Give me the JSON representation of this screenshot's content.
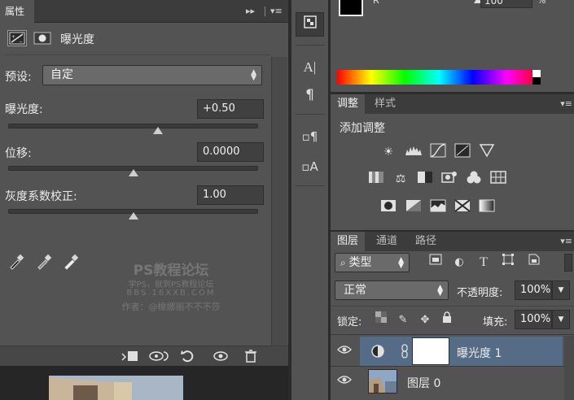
{
  "properties": {
    "tab_label": "属性",
    "title": "曝光度",
    "preset_label": "预设:",
    "preset_value": "自定",
    "exposure": {
      "label": "曝光度:",
      "value": "+0.50",
      "slider": 0.6
    },
    "offset": {
      "label": "位移:",
      "value": "0.0000",
      "slider": 0.5
    },
    "gamma": {
      "label": "灰度系数校正:",
      "value": "1.00",
      "slider": 0.5
    },
    "watermark": {
      "line1": "PS教程论坛",
      "line2": "学PS，就到PS教程论坛",
      "line3": "BBS.16XXB.COM",
      "line4": "作者：@椽娜丽不不不莎"
    }
  },
  "color_panel": {
    "channel_letter": "R",
    "value": "100",
    "percent": "%"
  },
  "adjustments": {
    "tabs": [
      {
        "label": "调整"
      },
      {
        "label": "样式"
      }
    ],
    "title": "添加调整"
  },
  "layers": {
    "tabs": [
      {
        "label": "图层"
      },
      {
        "label": "通道"
      },
      {
        "label": "路径"
      }
    ],
    "filter_kind": "类型",
    "blend_mode": "正常",
    "opacity_label": "不透明度:",
    "opacity_value": "100%",
    "lock_label": "锁定:",
    "fill_label": "填充:",
    "fill_value": "100%",
    "items": [
      {
        "name": "曝光度 1"
      },
      {
        "name": "图层 0"
      }
    ]
  },
  "colors": {
    "panel_bg": "#535353",
    "selected_layer": "#566c86",
    "dark_bg": "#2b2b2b"
  }
}
